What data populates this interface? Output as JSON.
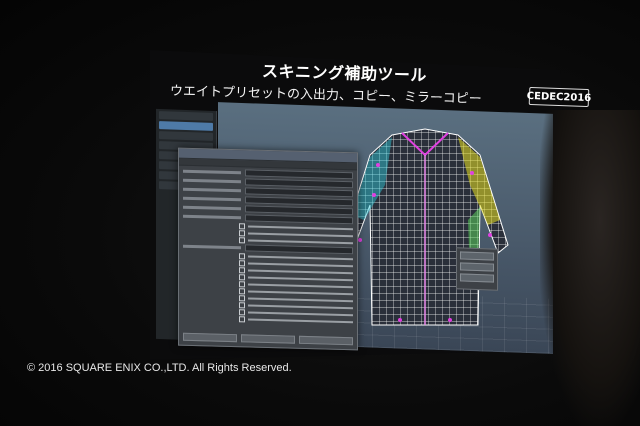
{
  "slide": {
    "title": "スキニング補助ツール",
    "subtitle": "ウエイトプリセットの入出力、コピー、ミラーコピー",
    "brand_logo": "CEDEC2016"
  },
  "footer": {
    "copyright": "© 2016 SQUARE ENIX CO.,LTD. All Rights Reserved."
  },
  "colors": {
    "wireframe_white": "#ffffff",
    "wireframe_magenta": "#e040e0",
    "wireframe_yellow": "#e8e020",
    "wireframe_cyan": "#30d0e0",
    "viewport_bg": "#5a6f80"
  }
}
